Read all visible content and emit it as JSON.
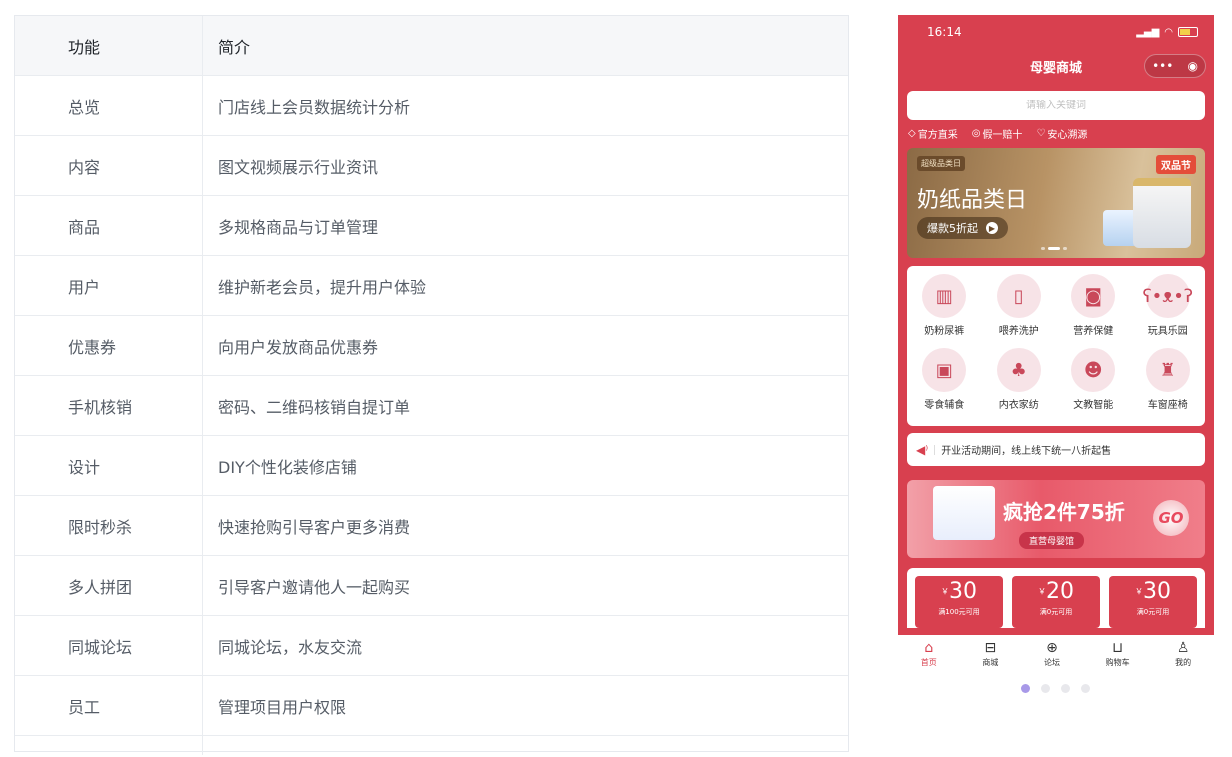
{
  "table": {
    "header": {
      "col1": "功能",
      "col2": "简介"
    },
    "rows": [
      {
        "name": "总览",
        "desc": "门店线上会员数据统计分析"
      },
      {
        "name": "内容",
        "desc": "图文视频展示行业资讯"
      },
      {
        "name": "商品",
        "desc": "多规格商品与订单管理"
      },
      {
        "name": "用户",
        "desc": "维护新老会员，提升用户体验"
      },
      {
        "name": "优惠券",
        "desc": "向用户发放商品优惠券"
      },
      {
        "name": "手机核销",
        "desc": "密码、二维码核销自提订单"
      },
      {
        "name": "设计",
        "desc": "DIY个性化装修店铺"
      },
      {
        "name": "限时秒杀",
        "desc": "快速抢购引导客户更多消费"
      },
      {
        "name": "多人拼团",
        "desc": "引导客户邀请他人一起购买"
      },
      {
        "name": "同城论坛",
        "desc": "同城论坛，水友交流"
      },
      {
        "name": "员工",
        "desc": "管理项目用户权限"
      }
    ]
  },
  "phone": {
    "status_time": "16:14",
    "title": "母婴商城",
    "search_placeholder": "请输入关键词",
    "badges": [
      "官方直采",
      "假一赔十",
      "安心溯源"
    ],
    "banner": {
      "tag": "超级品类日",
      "logo": "双品节",
      "headline": "奶纸品类日",
      "pill": "爆款5折起"
    },
    "categories": [
      {
        "label": "奶粉尿裤",
        "icon": "milk-powder-icon"
      },
      {
        "label": "喂养洗护",
        "icon": "bottle-icon"
      },
      {
        "label": "营养保健",
        "icon": "supplement-icon"
      },
      {
        "label": "玩具乐园",
        "icon": "teddy-bear-icon"
      },
      {
        "label": "零食辅食",
        "icon": "snack-jar-icon"
      },
      {
        "label": "内衣家纺",
        "icon": "clothes-icon"
      },
      {
        "label": "文教智能",
        "icon": "toy-robot-icon"
      },
      {
        "label": "车窗座椅",
        "icon": "car-seat-icon"
      }
    ],
    "notice": "开业活动期间，线上线下统一八折起售",
    "promo": {
      "headline": "疯抢2件75折",
      "sub": "直营母婴馆",
      "go": "GO"
    },
    "coupons": [
      {
        "currency": "￥",
        "amount": "30",
        "cond": "满100元可用"
      },
      {
        "currency": "￥",
        "amount": "20",
        "cond": "满0元可用"
      },
      {
        "currency": "￥",
        "amount": "30",
        "cond": "满0元可用"
      }
    ],
    "tabs": [
      "首页",
      "商城",
      "论坛",
      "购物车",
      "我的"
    ],
    "accent": "#d8404f"
  },
  "pager": {
    "count": 4,
    "active": 0
  }
}
